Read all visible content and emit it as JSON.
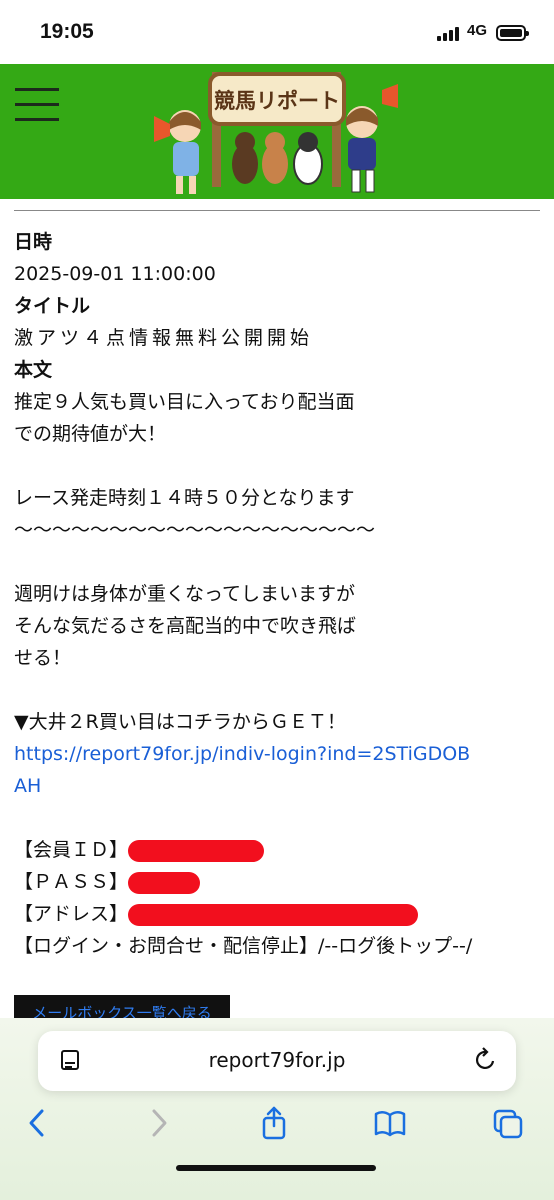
{
  "status_bar": {
    "time": "19:05",
    "network": "4G"
  },
  "header": {
    "logo_text": "競馬リポート"
  },
  "message": {
    "date_label": "日時",
    "date_value": "2025-09-01 11:00:00",
    "title_label": "タイトル",
    "title_value": "激アツ４点情報無料公開開始",
    "body_label": "本文",
    "body_lines": [
      "推定９人気も買い目に入っており配当面",
      "での期待値が大！",
      "",
      "レース発走時刻１４時５０分となります",
      "〜〜〜〜〜〜〜〜〜〜〜〜〜〜〜〜〜〜〜",
      "",
      "週明けは身体が重くなってしまいますが",
      "そんな気だるさを高配当的中で吹き飛ば",
      "せる！",
      "",
      "▼大井２R買い目はコチラからＧＥＴ！"
    ],
    "link_line1": "https://report79for.jp/indiv-login?ind=2STiGDOB",
    "link_line2": "AH",
    "member_id_label": "【会員ＩＤ】",
    "pass_label": "【ＰＡＳＳ】",
    "address_label": "【アドレス】",
    "footer_links": "【ログイン・お問合せ・配信停止】/--ログ後トップ--/"
  },
  "mailbox_button": "メールボックス一覧へ戻る",
  "browser": {
    "url": "report79for.jp"
  },
  "colors": {
    "header_green": "#34a915",
    "link_blue": "#1a5fd6",
    "redaction_red": "#f20f1e"
  }
}
